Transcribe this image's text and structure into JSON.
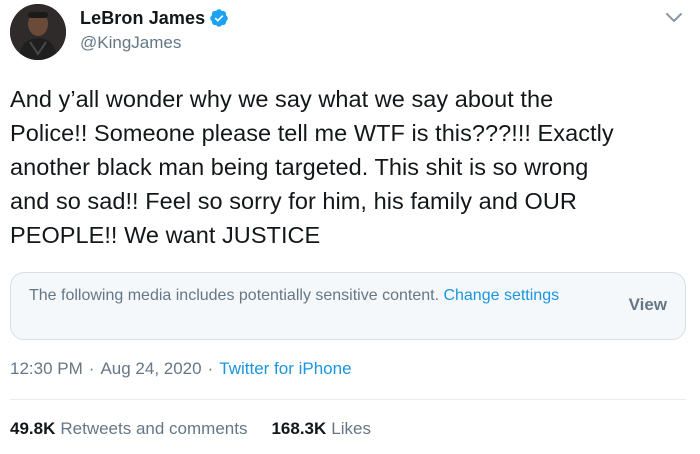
{
  "user": {
    "display_name": "LeBron James",
    "handle": "@KingJames",
    "verified_icon": "verified-badge-icon",
    "avatar": "avatar"
  },
  "menu": {
    "icon": "chevron-down-icon"
  },
  "tweet": {
    "text": "And y’all wonder why we say what we say about the\nPolice!! Someone please tell me WTF is this???!!! Exactly\nanother black man being targeted. This shit is so wrong\nand so sad!! Feel so sorry for him, his family and OUR\nPEOPLE!! We want JUSTICE"
  },
  "sensitive_media": {
    "notice": "The following media includes potentially sensitive content. ",
    "change_settings": "Change settings",
    "view_label": "View"
  },
  "meta": {
    "time": "12:30 PM",
    "separator": "·",
    "date": "Aug 24, 2020",
    "separator2": "·",
    "source": "Twitter for iPhone"
  },
  "stats": {
    "retweets_count": "49.8K",
    "retweets_label": "Retweets and comments",
    "likes_count": "168.3K",
    "likes_label": "Likes"
  },
  "colors": {
    "link": "#1b95e0",
    "muted": "#657786",
    "text": "#14171a",
    "verified": "#1da1f2"
  }
}
